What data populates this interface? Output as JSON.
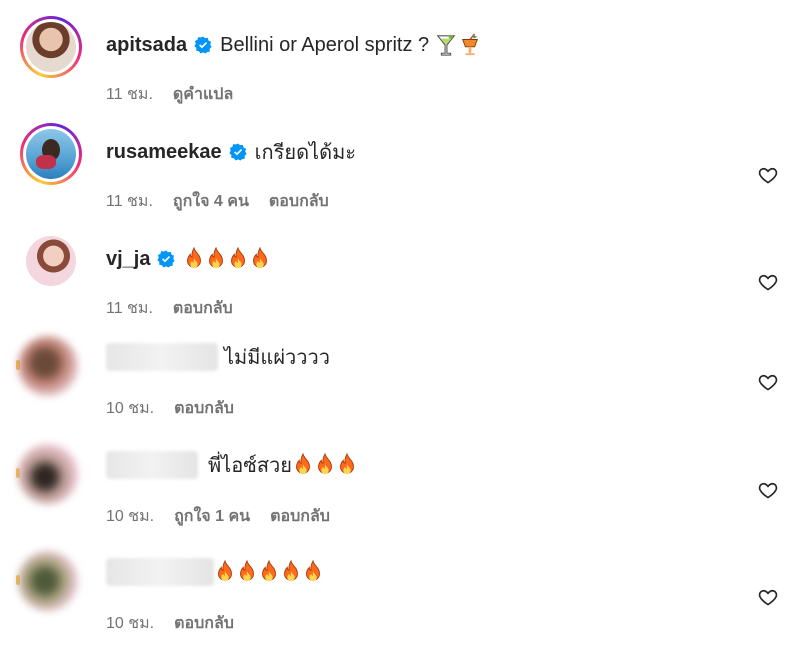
{
  "comments": [
    {
      "username": "apitsada",
      "verified": true,
      "text": "Bellini or Aperol spritz ?",
      "emoji": [
        "cocktail-glass",
        "tropical-drink"
      ],
      "time": "11 ชม.",
      "likes": "",
      "reply": "ดูคำแปล",
      "has_heart": false
    },
    {
      "username": "rusameekae",
      "verified": true,
      "text": "เกรียดได้มะ",
      "emoji": [],
      "time": "11 ชม.",
      "likes": "ถูกใจ 4 คน",
      "reply": "ตอบกลับ",
      "has_heart": true
    },
    {
      "username": "vj_ja",
      "verified": true,
      "text": "",
      "emoji": [
        "fire",
        "fire",
        "fire",
        "fire"
      ],
      "time": "11 ชม.",
      "likes": "",
      "reply": "ตอบกลับ",
      "has_heart": true
    },
    {
      "username": "",
      "verified": false,
      "text": "ไม่มีแผ่วววว",
      "emoji": [],
      "time": "10 ชม.",
      "likes": "",
      "reply": "ตอบกลับ",
      "has_heart": true
    },
    {
      "username": "",
      "verified": false,
      "text": "พี่ไอซ์สวย",
      "emoji": [
        "fire",
        "fire",
        "fire"
      ],
      "time": "10 ชม.",
      "likes": "ถูกใจ 1 คน",
      "reply": "ตอบกลับ",
      "has_heart": true
    },
    {
      "username": "",
      "verified": false,
      "text": "",
      "emoji": [
        "fire",
        "fire",
        "fire",
        "fire",
        "fire"
      ],
      "time": "10 ชม.",
      "likes": "",
      "reply": "ตอบกลับ",
      "has_heart": true
    }
  ],
  "colors": {
    "verified": "#0095f6",
    "text": "#262626",
    "meta": "#737373",
    "fire": "#ff6a1a"
  }
}
